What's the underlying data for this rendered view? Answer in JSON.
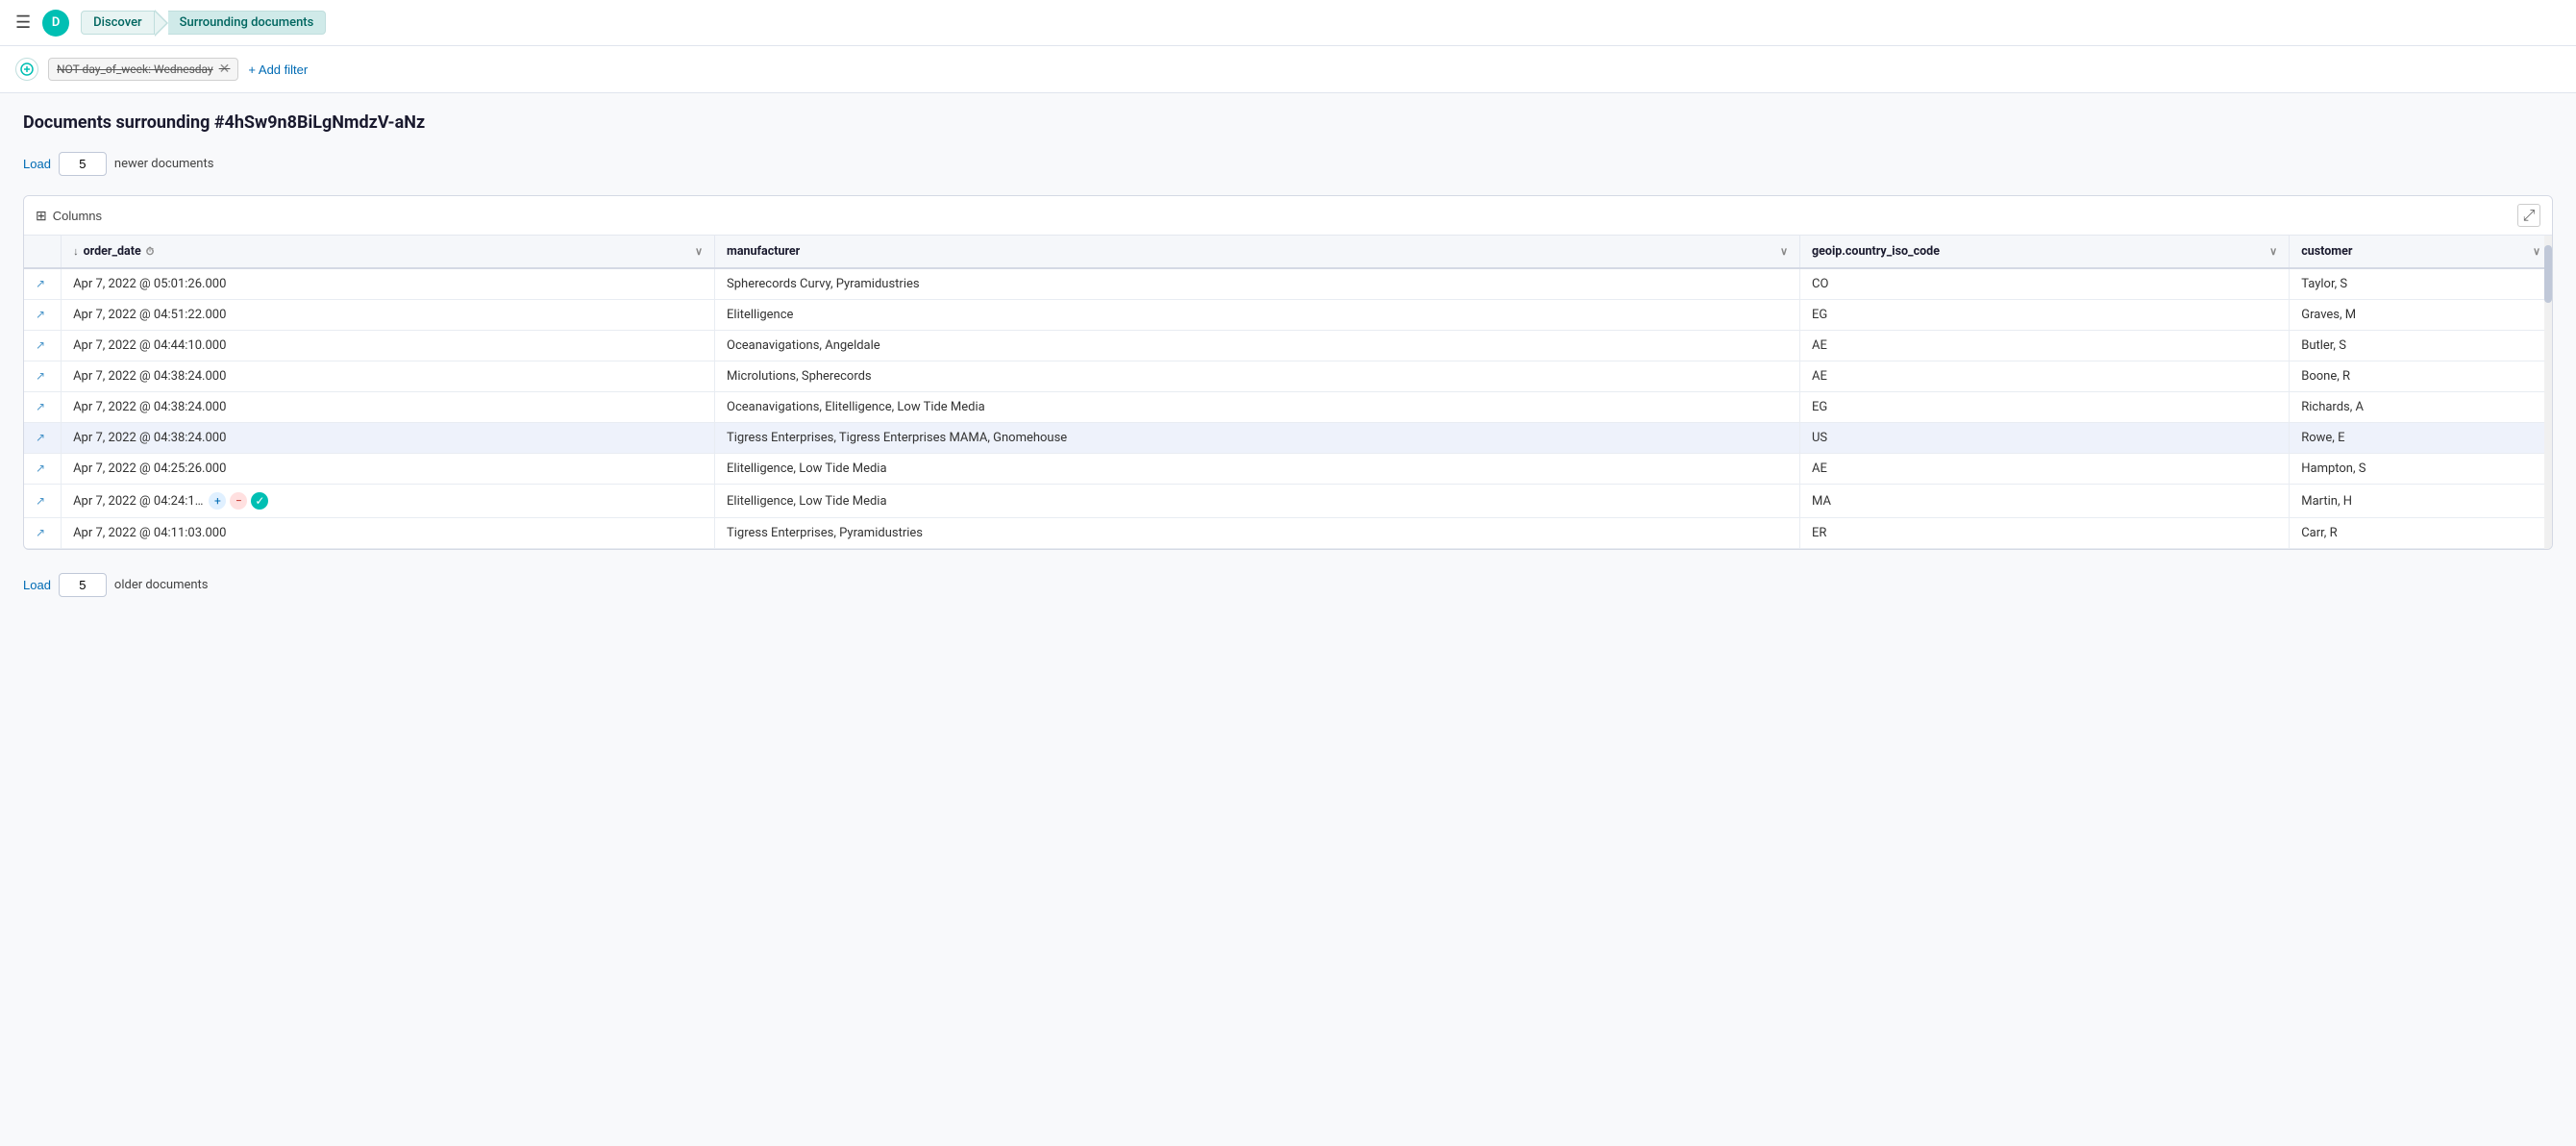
{
  "nav": {
    "hamburger": "☰",
    "avatar_letter": "D",
    "breadcrumb_discover": "Discover",
    "breadcrumb_current": "Surrounding documents"
  },
  "filter_bar": {
    "filter_chip_text": "NOT day_of_week: Wednesday",
    "add_filter_label": "+ Add filter"
  },
  "main": {
    "page_title": "Documents surrounding #4hSw9n8BiLgNmdzV-aNz",
    "load_newer_label": "Load",
    "load_newer_count": "5",
    "load_newer_suffix": "newer documents",
    "load_older_label": "Load",
    "load_older_count": "5",
    "load_older_suffix": "older documents",
    "table": {
      "toolbar_columns": "Columns",
      "columns": [
        {
          "label": "order_date",
          "has_sort": true,
          "has_info": true,
          "has_chevron": true
        },
        {
          "label": "manufacturer",
          "has_sort": false,
          "has_info": false,
          "has_chevron": true
        },
        {
          "label": "geoip.country_iso_code",
          "has_sort": false,
          "has_info": false,
          "has_chevron": true
        },
        {
          "label": "customer",
          "has_sort": false,
          "has_info": false,
          "has_chevron": true
        }
      ],
      "rows": [
        {
          "order_date": "Apr 7, 2022 @ 05:01:26.000",
          "manufacturer": "Spherecords Curvy, Pyramidustries",
          "geo": "CO",
          "customer": "Taylor, S",
          "highlighted": false,
          "show_actions": false
        },
        {
          "order_date": "Apr 7, 2022 @ 04:51:22.000",
          "manufacturer": "Elitelligence",
          "geo": "EG",
          "customer": "Graves, M",
          "highlighted": false,
          "show_actions": false
        },
        {
          "order_date": "Apr 7, 2022 @ 04:44:10.000",
          "manufacturer": "Oceanavigations, Angeldale",
          "geo": "AE",
          "customer": "Butler, S",
          "highlighted": false,
          "show_actions": false
        },
        {
          "order_date": "Apr 7, 2022 @ 04:38:24.000",
          "manufacturer": "Microlutions, Spherecords",
          "geo": "AE",
          "customer": "Boone, R",
          "highlighted": false,
          "show_actions": false
        },
        {
          "order_date": "Apr 7, 2022 @ 04:38:24.000",
          "manufacturer": "Oceanavigations, Elitelligence, Low Tide Media",
          "geo": "EG",
          "customer": "Richards, A",
          "highlighted": false,
          "show_actions": false
        },
        {
          "order_date": "Apr 7, 2022 @ 04:38:24.000",
          "manufacturer": "Tigress Enterprises, Tigress Enterprises MAMA, Gnomehouse",
          "geo": "US",
          "customer": "Rowe, E",
          "highlighted": true,
          "show_actions": false
        },
        {
          "order_date": "Apr 7, 2022 @ 04:25:26.000",
          "manufacturer": "Elitelligence, Low Tide Media",
          "geo": "AE",
          "customer": "Hampton, S",
          "highlighted": false,
          "show_actions": false
        },
        {
          "order_date": "Apr 7, 2022 @ 04:24:1…",
          "manufacturer": "Elitelligence, Low Tide Media",
          "geo": "MA",
          "customer": "Martin, H",
          "highlighted": false,
          "show_actions": true
        },
        {
          "order_date": "Apr 7, 2022 @ 04:11:03.000",
          "manufacturer": "Tigress Enterprises, Pyramidustries",
          "geo": "ER",
          "customer": "Carr, R",
          "highlighted": false,
          "show_actions": false
        }
      ]
    }
  }
}
